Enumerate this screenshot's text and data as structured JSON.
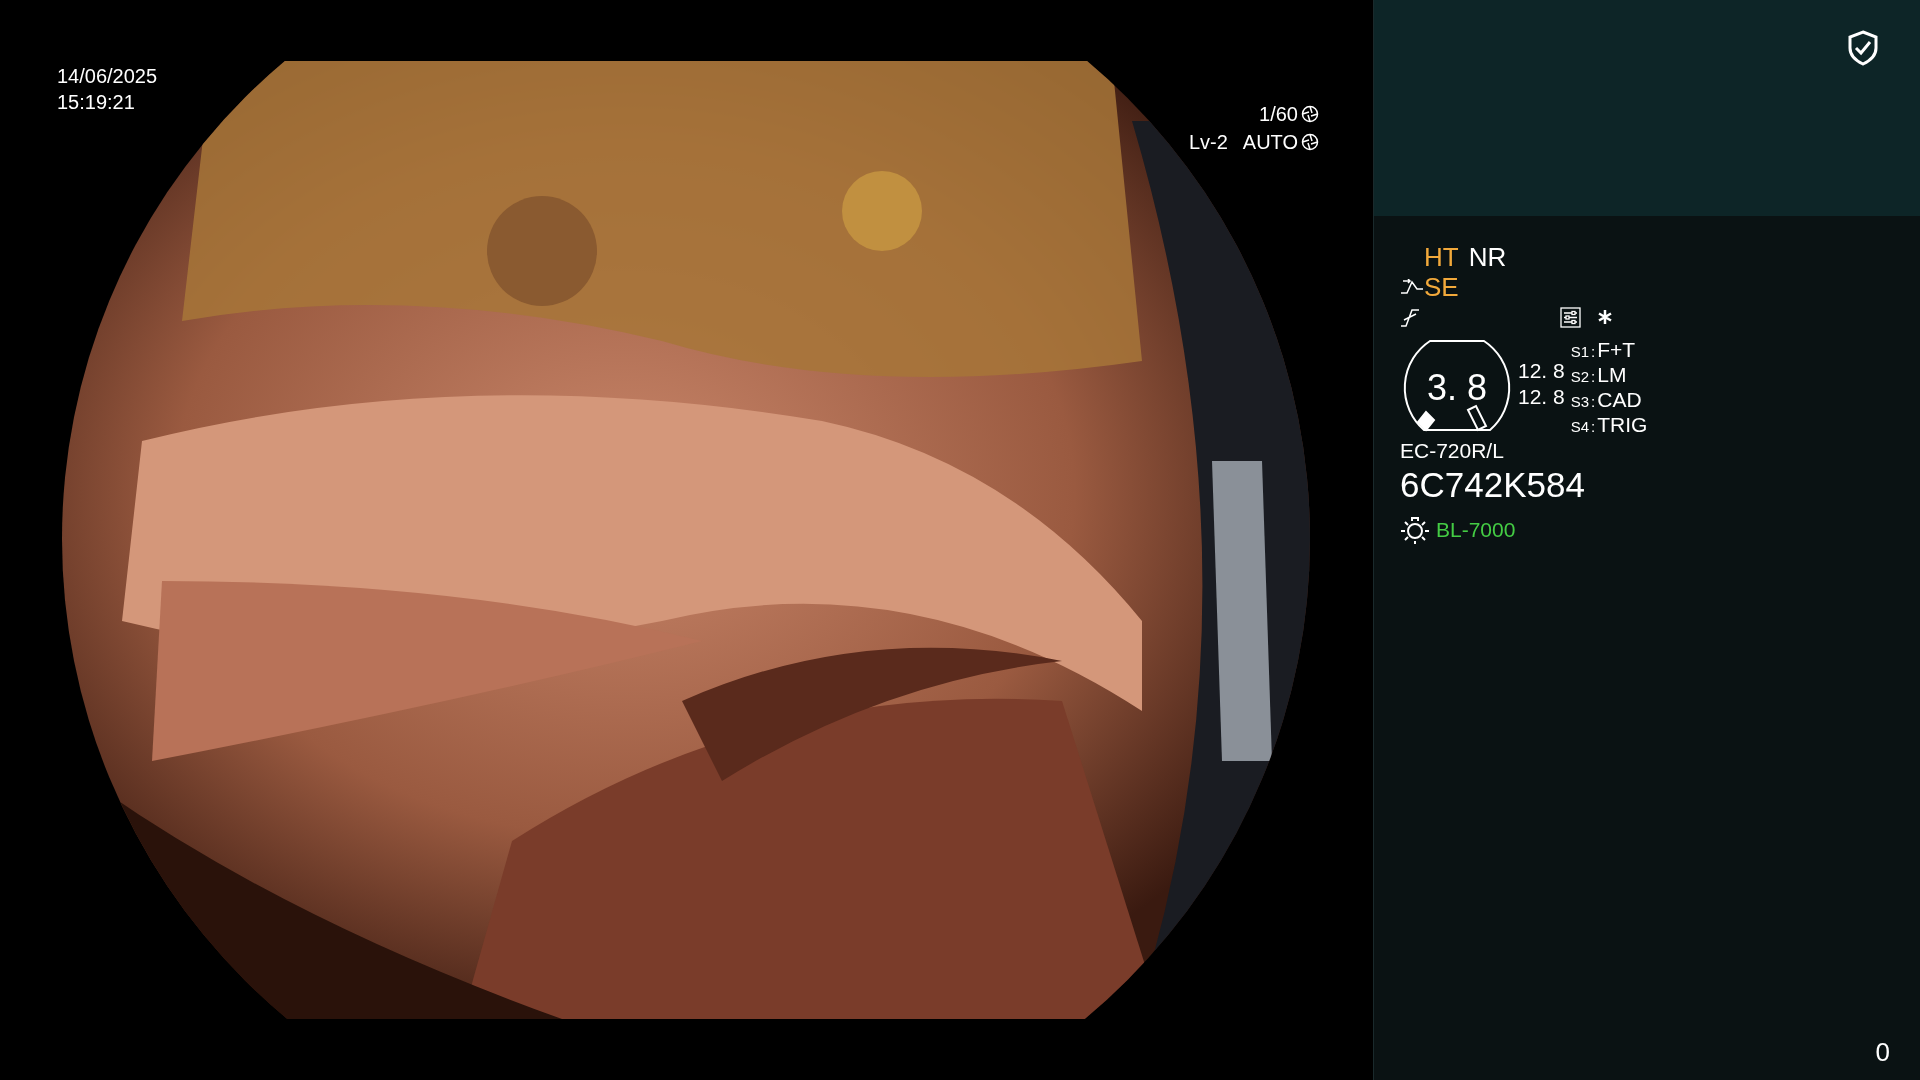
{
  "overlay": {
    "date": "14/06/2025",
    "time": "15:19:21",
    "shutter": "1/60",
    "level": "Lv-2",
    "mode": "AUTO"
  },
  "panel": {
    "modes_row1": [
      {
        "label": "HT",
        "active": true
      },
      {
        "label": "NR",
        "active": false
      }
    ],
    "modes_row2": [
      {
        "label": "SE",
        "active": true
      }
    ],
    "gauge": {
      "value": "3. 8",
      "readings": [
        "12. 8",
        "12. 8"
      ]
    },
    "switches": [
      {
        "key": "S1",
        "sep": ":",
        "label": "F+T"
      },
      {
        "key": "S2",
        "sep": ":",
        "label": "LM"
      },
      {
        "key": "S3",
        "sep": ":",
        "label": "CAD"
      },
      {
        "key": "S4",
        "sep": ":",
        "label": "TRIG"
      }
    ],
    "scope_model": "EC-720R/L",
    "scope_serial": "6C742K584",
    "light_source": "BL-7000",
    "counter": "0"
  }
}
